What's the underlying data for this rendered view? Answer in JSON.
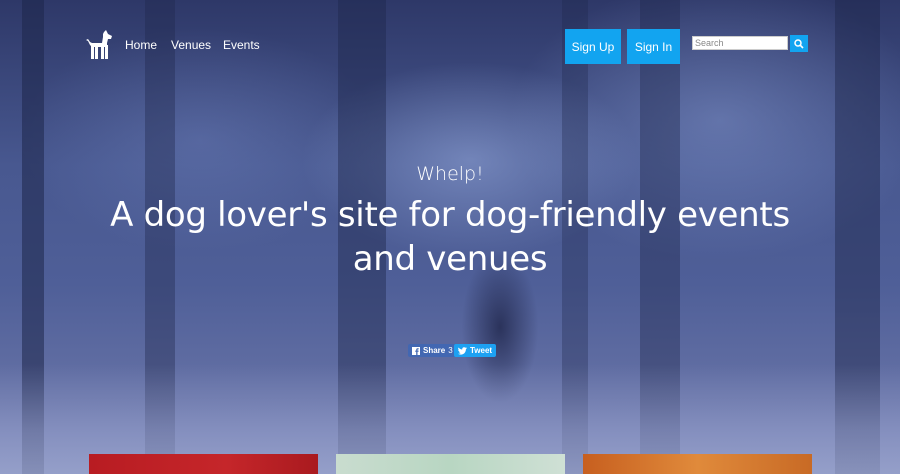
{
  "nav": {
    "links": [
      "Home",
      "Venues",
      "Events"
    ],
    "sign_up": "Sign Up",
    "sign_in": "Sign In",
    "search_placeholder": "Search"
  },
  "hero": {
    "kicker": "Whelp!",
    "headline": "A dog lover's site for dog-friendly events and venues"
  },
  "social": {
    "share_label": "Share",
    "share_count": "3",
    "tweet_label": "Tweet"
  },
  "colors": {
    "accent": "#12a4f0",
    "facebook": "#4267b2",
    "twitter": "#1da1f2"
  }
}
